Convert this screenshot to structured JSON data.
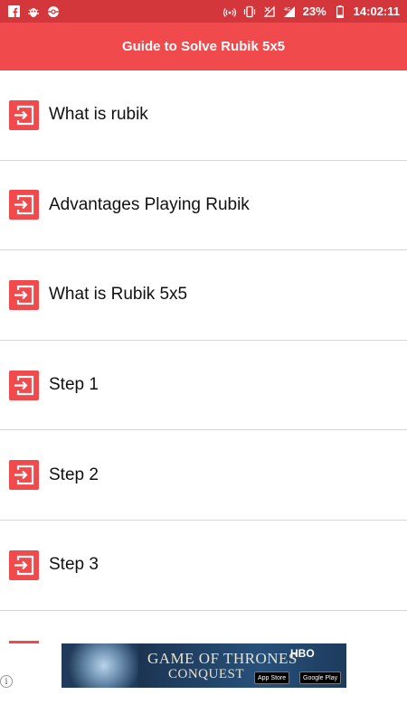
{
  "status_bar": {
    "left_icons": [
      "facebook-icon",
      "bug-icon",
      "pokeball-icon"
    ],
    "right_icons": [
      "hotspot-icon",
      "vibrate-icon",
      "no-signal-icon",
      "4g-signal-icon"
    ],
    "battery": "23%",
    "time": "14:02:11"
  },
  "app_bar": {
    "title": "Guide to Solve Rubik 5x5"
  },
  "list": {
    "items": [
      {
        "label": "What is rubik"
      },
      {
        "label": "Advantages Playing Rubik"
      },
      {
        "label": "What is Rubik 5x5"
      },
      {
        "label": "Step 1"
      },
      {
        "label": "Step 2"
      },
      {
        "label": "Step 3"
      }
    ]
  },
  "ad": {
    "title_line1": "GAME OF THRONES",
    "title_line2": "CONQUEST",
    "brand": "HBO",
    "app_store": "App Store",
    "google_play": "Google Play",
    "info_icon": "info-icon"
  },
  "colors": {
    "status_bar": "#d3373c",
    "app_bar": "#f04a4c",
    "icon_bg": "#f04a4c",
    "divider": "#d6d6d6"
  }
}
